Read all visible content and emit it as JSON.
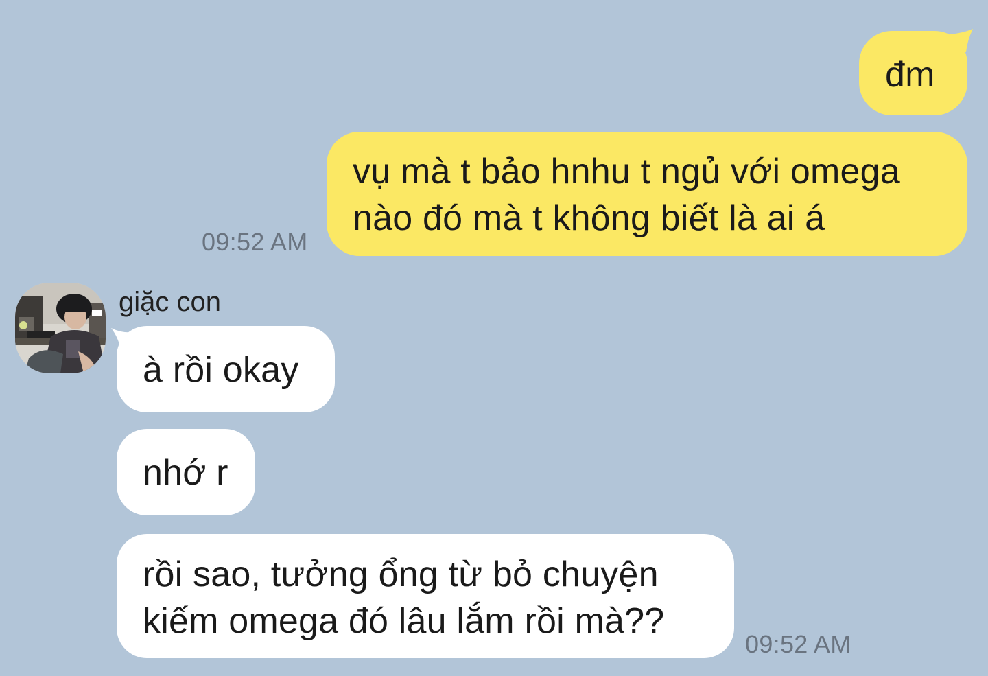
{
  "colors": {
    "background": "#b2c5d8",
    "outgoing_bubble": "#fbe864",
    "incoming_bubble": "#ffffff",
    "timestamp": "#6a7480"
  },
  "outgoing": {
    "msg1": "đm",
    "msg2_line1": "vụ mà t bảo hnhu t ngủ với omega",
    "msg2_line2": "nào đó mà t không biết là ai á",
    "time": "09:52 AM"
  },
  "incoming": {
    "sender": "giặc con",
    "avatar_icon": "avatar-photo",
    "msg1": "à rồi okay",
    "msg2": "nhớ r",
    "msg3_line1": "rồi sao, tưởng ổng từ bỏ chuyện",
    "msg3_line2": "kiếm omega đó lâu lắm rồi mà??",
    "time": "09:52 AM"
  }
}
